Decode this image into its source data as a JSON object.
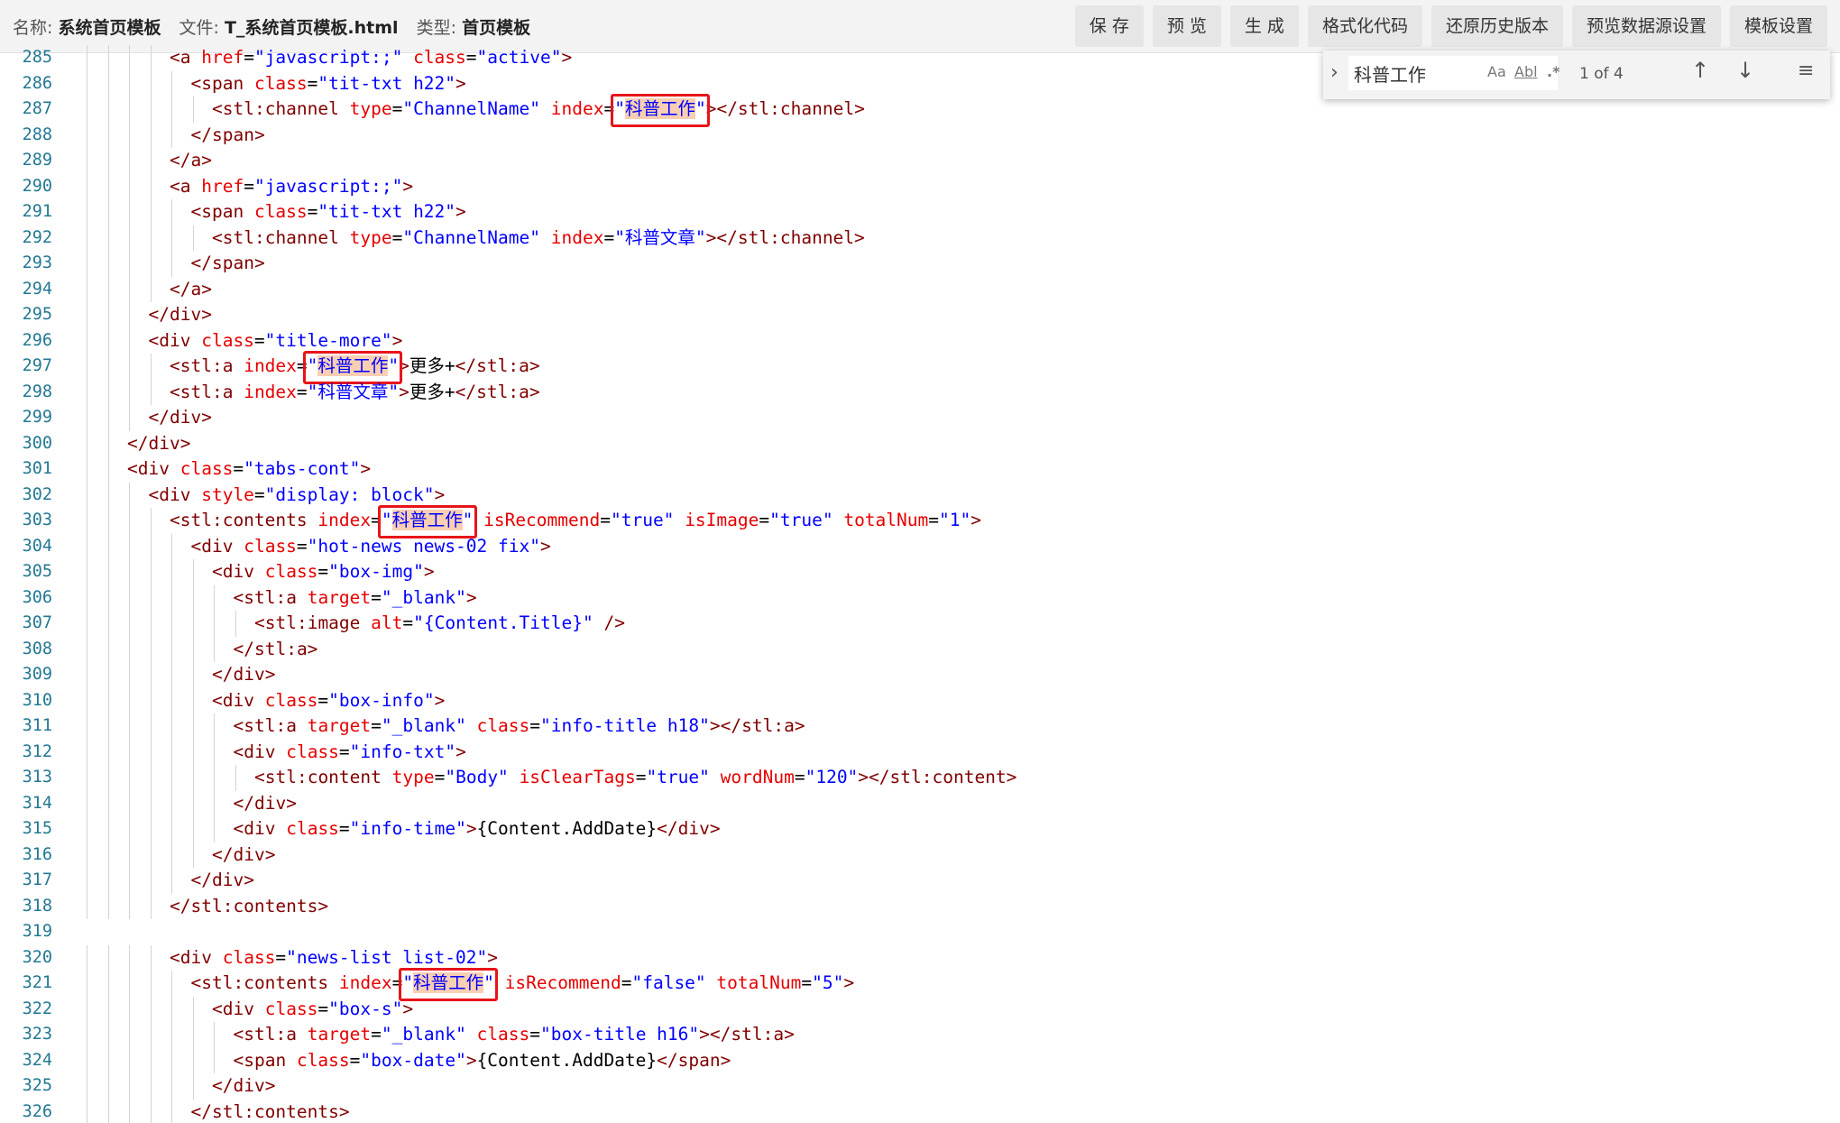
{
  "header": {
    "name_label": "名称:",
    "name_value": "系统首页模板",
    "file_label": "文件:",
    "file_value": "T_系统首页模板.html",
    "type_label": "类型:",
    "type_value": "首页模板",
    "buttons": [
      "保 存",
      "预 览",
      "生 成",
      "格式化代码",
      "还原历史版本",
      "预览数据源设置",
      "模板设置"
    ]
  },
  "find": {
    "query": "科普工作",
    "count": "1 of 4",
    "match_case_icon": "Aa",
    "whole_word_icon": "Abl",
    "regex_icon": ".*"
  },
  "colors": {
    "match_highlight": "#f8cfb3",
    "annotation_box": "#e8141a",
    "line_number": "#237893",
    "tag": "#800000",
    "attribute": "#e50000",
    "string": "#0000ff"
  },
  "editor": {
    "lines": [
      {
        "n": "285",
        "indent": 8,
        "tokens": [
          [
            "tag",
            "<a"
          ],
          [
            "txt",
            " "
          ],
          [
            "attr",
            "href"
          ],
          [
            "txt",
            "="
          ],
          [
            "str",
            "\"javascript:;\""
          ],
          [
            "txt",
            " "
          ],
          [
            "attr",
            "class"
          ],
          [
            "txt",
            "="
          ],
          [
            "str",
            "\"active\""
          ],
          [
            "tag",
            ">"
          ]
        ]
      },
      {
        "n": "286",
        "indent": 10,
        "tokens": [
          [
            "tag",
            "<span"
          ],
          [
            "txt",
            " "
          ],
          [
            "attr",
            "class"
          ],
          [
            "txt",
            "="
          ],
          [
            "str",
            "\"tit-txt h22\""
          ],
          [
            "tag",
            ">"
          ]
        ]
      },
      {
        "n": "287",
        "indent": 12,
        "tokens": [
          [
            "tag",
            "<stl:channel"
          ],
          [
            "txt",
            " "
          ],
          [
            "attr",
            "type"
          ],
          [
            "txt",
            "="
          ],
          [
            "str",
            "\"ChannelName\""
          ],
          [
            "txt",
            " "
          ],
          [
            "attr",
            "index"
          ],
          [
            "txt",
            "="
          ],
          [
            "str",
            "\""
          ],
          [
            "hl",
            "科普工作"
          ],
          [
            "str",
            "\""
          ],
          [
            "tag",
            ">"
          ],
          [
            "tag",
            "</stl:channel>"
          ]
        ],
        "boxed": true
      },
      {
        "n": "288",
        "indent": 10,
        "tokens": [
          [
            "tag",
            "</span>"
          ]
        ]
      },
      {
        "n": "289",
        "indent": 8,
        "tokens": [
          [
            "tag",
            "</a>"
          ]
        ]
      },
      {
        "n": "290",
        "indent": 8,
        "tokens": [
          [
            "tag",
            "<a"
          ],
          [
            "txt",
            " "
          ],
          [
            "attr",
            "href"
          ],
          [
            "txt",
            "="
          ],
          [
            "str",
            "\"javascript:;\""
          ],
          [
            "tag",
            ">"
          ]
        ]
      },
      {
        "n": "291",
        "indent": 10,
        "tokens": [
          [
            "tag",
            "<span"
          ],
          [
            "txt",
            " "
          ],
          [
            "attr",
            "class"
          ],
          [
            "txt",
            "="
          ],
          [
            "str",
            "\"tit-txt h22\""
          ],
          [
            "tag",
            ">"
          ]
        ]
      },
      {
        "n": "292",
        "indent": 12,
        "tokens": [
          [
            "tag",
            "<stl:channel"
          ],
          [
            "txt",
            " "
          ],
          [
            "attr",
            "type"
          ],
          [
            "txt",
            "="
          ],
          [
            "str",
            "\"ChannelName\""
          ],
          [
            "txt",
            " "
          ],
          [
            "attr",
            "index"
          ],
          [
            "txt",
            "="
          ],
          [
            "str",
            "\"科普文章\""
          ],
          [
            "tag",
            ">"
          ],
          [
            "tag",
            "</stl:channel>"
          ]
        ]
      },
      {
        "n": "293",
        "indent": 10,
        "tokens": [
          [
            "tag",
            "</span>"
          ]
        ]
      },
      {
        "n": "294",
        "indent": 8,
        "tokens": [
          [
            "tag",
            "</a>"
          ]
        ]
      },
      {
        "n": "295",
        "indent": 6,
        "tokens": [
          [
            "tag",
            "</div>"
          ]
        ]
      },
      {
        "n": "296",
        "indent": 6,
        "tokens": [
          [
            "tag",
            "<div"
          ],
          [
            "txt",
            " "
          ],
          [
            "attr",
            "class"
          ],
          [
            "txt",
            "="
          ],
          [
            "str",
            "\"title-more\""
          ],
          [
            "tag",
            ">"
          ]
        ]
      },
      {
        "n": "297",
        "indent": 8,
        "tokens": [
          [
            "tag",
            "<stl:a"
          ],
          [
            "txt",
            " "
          ],
          [
            "attr",
            "index"
          ],
          [
            "txt",
            "="
          ],
          [
            "str",
            "\""
          ],
          [
            "hl",
            "科普工作"
          ],
          [
            "str",
            "\""
          ],
          [
            "tag",
            ">"
          ],
          [
            "txt",
            "更多+"
          ],
          [
            "tag",
            "</stl:a>"
          ]
        ],
        "boxed": true
      },
      {
        "n": "298",
        "indent": 8,
        "tokens": [
          [
            "tag",
            "<stl:a"
          ],
          [
            "txt",
            " "
          ],
          [
            "attr",
            "index"
          ],
          [
            "txt",
            "="
          ],
          [
            "str",
            "\"科普文章\""
          ],
          [
            "tag",
            ">"
          ],
          [
            "txt",
            "更多+"
          ],
          [
            "tag",
            "</stl:a>"
          ]
        ]
      },
      {
        "n": "299",
        "indent": 6,
        "tokens": [
          [
            "tag",
            "</div>"
          ]
        ]
      },
      {
        "n": "300",
        "indent": 4,
        "tokens": [
          [
            "tag",
            "</div>"
          ]
        ]
      },
      {
        "n": "301",
        "indent": 4,
        "tokens": [
          [
            "tag",
            "<div"
          ],
          [
            "txt",
            " "
          ],
          [
            "attr",
            "class"
          ],
          [
            "txt",
            "="
          ],
          [
            "str",
            "\"tabs-cont\""
          ],
          [
            "tag",
            ">"
          ]
        ]
      },
      {
        "n": "302",
        "indent": 6,
        "tokens": [
          [
            "tag",
            "<div"
          ],
          [
            "txt",
            " "
          ],
          [
            "attr",
            "style"
          ],
          [
            "txt",
            "="
          ],
          [
            "str",
            "\"display: block\""
          ],
          [
            "tag",
            ">"
          ]
        ]
      },
      {
        "n": "303",
        "indent": 8,
        "tokens": [
          [
            "tag",
            "<stl:contents"
          ],
          [
            "txt",
            " "
          ],
          [
            "attr",
            "index"
          ],
          [
            "txt",
            "="
          ],
          [
            "str",
            "\""
          ],
          [
            "hl",
            "科普工作"
          ],
          [
            "str",
            "\""
          ],
          [
            "txt",
            " "
          ],
          [
            "attr",
            "isRecommend"
          ],
          [
            "txt",
            "="
          ],
          [
            "str",
            "\"true\""
          ],
          [
            "txt",
            " "
          ],
          [
            "attr",
            "isImage"
          ],
          [
            "txt",
            "="
          ],
          [
            "str",
            "\"true\""
          ],
          [
            "txt",
            " "
          ],
          [
            "attr",
            "totalNum"
          ],
          [
            "txt",
            "="
          ],
          [
            "str",
            "\"1\""
          ],
          [
            "tag",
            ">"
          ]
        ],
        "boxed": true
      },
      {
        "n": "304",
        "indent": 10,
        "tokens": [
          [
            "tag",
            "<div"
          ],
          [
            "txt",
            " "
          ],
          [
            "attr",
            "class"
          ],
          [
            "txt",
            "="
          ],
          [
            "str",
            "\"hot-news news-02 fix\""
          ],
          [
            "tag",
            ">"
          ]
        ]
      },
      {
        "n": "305",
        "indent": 12,
        "tokens": [
          [
            "tag",
            "<div"
          ],
          [
            "txt",
            " "
          ],
          [
            "attr",
            "class"
          ],
          [
            "txt",
            "="
          ],
          [
            "str",
            "\"box-img\""
          ],
          [
            "tag",
            ">"
          ]
        ]
      },
      {
        "n": "306",
        "indent": 14,
        "tokens": [
          [
            "tag",
            "<stl:a"
          ],
          [
            "txt",
            " "
          ],
          [
            "attr",
            "target"
          ],
          [
            "txt",
            "="
          ],
          [
            "str",
            "\"_blank\""
          ],
          [
            "tag",
            ">"
          ]
        ]
      },
      {
        "n": "307",
        "indent": 16,
        "tokens": [
          [
            "tag",
            "<stl:image"
          ],
          [
            "txt",
            " "
          ],
          [
            "attr",
            "alt"
          ],
          [
            "txt",
            "="
          ],
          [
            "str",
            "\"{Content.Title}\""
          ],
          [
            "txt",
            " "
          ],
          [
            "tag",
            "/>"
          ]
        ]
      },
      {
        "n": "308",
        "indent": 14,
        "tokens": [
          [
            "tag",
            "</stl:a>"
          ]
        ]
      },
      {
        "n": "309",
        "indent": 12,
        "tokens": [
          [
            "tag",
            "</div>"
          ]
        ]
      },
      {
        "n": "310",
        "indent": 12,
        "tokens": [
          [
            "tag",
            "<div"
          ],
          [
            "txt",
            " "
          ],
          [
            "attr",
            "class"
          ],
          [
            "txt",
            "="
          ],
          [
            "str",
            "\"box-info\""
          ],
          [
            "tag",
            ">"
          ]
        ]
      },
      {
        "n": "311",
        "indent": 14,
        "tokens": [
          [
            "tag",
            "<stl:a"
          ],
          [
            "txt",
            " "
          ],
          [
            "attr",
            "target"
          ],
          [
            "txt",
            "="
          ],
          [
            "str",
            "\"_blank\""
          ],
          [
            "txt",
            " "
          ],
          [
            "attr",
            "class"
          ],
          [
            "txt",
            "="
          ],
          [
            "str",
            "\"info-title h18\""
          ],
          [
            "tag",
            ">"
          ],
          [
            "tag",
            "</stl:a>"
          ]
        ]
      },
      {
        "n": "312",
        "indent": 14,
        "tokens": [
          [
            "tag",
            "<div"
          ],
          [
            "txt",
            " "
          ],
          [
            "attr",
            "class"
          ],
          [
            "txt",
            "="
          ],
          [
            "str",
            "\"info-txt\""
          ],
          [
            "tag",
            ">"
          ]
        ]
      },
      {
        "n": "313",
        "indent": 16,
        "tokens": [
          [
            "tag",
            "<stl:content"
          ],
          [
            "txt",
            " "
          ],
          [
            "attr",
            "type"
          ],
          [
            "txt",
            "="
          ],
          [
            "str",
            "\"Body\""
          ],
          [
            "txt",
            " "
          ],
          [
            "attr",
            "isClearTags"
          ],
          [
            "txt",
            "="
          ],
          [
            "str",
            "\"true\""
          ],
          [
            "txt",
            " "
          ],
          [
            "attr",
            "wordNum"
          ],
          [
            "txt",
            "="
          ],
          [
            "str",
            "\"120\""
          ],
          [
            "tag",
            ">"
          ],
          [
            "tag",
            "</stl:content>"
          ]
        ]
      },
      {
        "n": "314",
        "indent": 14,
        "tokens": [
          [
            "tag",
            "</div>"
          ]
        ]
      },
      {
        "n": "315",
        "indent": 14,
        "tokens": [
          [
            "tag",
            "<div"
          ],
          [
            "txt",
            " "
          ],
          [
            "attr",
            "class"
          ],
          [
            "txt",
            "="
          ],
          [
            "str",
            "\"info-time\""
          ],
          [
            "tag",
            ">"
          ],
          [
            "txt",
            "{Content.AddDate}"
          ],
          [
            "tag",
            "</div>"
          ]
        ]
      },
      {
        "n": "316",
        "indent": 12,
        "tokens": [
          [
            "tag",
            "</div>"
          ]
        ]
      },
      {
        "n": "317",
        "indent": 10,
        "tokens": [
          [
            "tag",
            "</div>"
          ]
        ]
      },
      {
        "n": "318",
        "indent": 8,
        "tokens": [
          [
            "tag",
            "</stl:contents>"
          ]
        ]
      },
      {
        "n": "319",
        "indent": 0,
        "tokens": []
      },
      {
        "n": "320",
        "indent": 8,
        "tokens": [
          [
            "tag",
            "<div"
          ],
          [
            "txt",
            " "
          ],
          [
            "attr",
            "class"
          ],
          [
            "txt",
            "="
          ],
          [
            "str",
            "\"news-list list-02\""
          ],
          [
            "tag",
            ">"
          ]
        ]
      },
      {
        "n": "321",
        "indent": 10,
        "tokens": [
          [
            "tag",
            "<stl:contents"
          ],
          [
            "txt",
            " "
          ],
          [
            "attr",
            "index"
          ],
          [
            "txt",
            "="
          ],
          [
            "str",
            "\""
          ],
          [
            "hl",
            "科普工作"
          ],
          [
            "str",
            "\""
          ],
          [
            "txt",
            " "
          ],
          [
            "attr",
            "isRecommend"
          ],
          [
            "txt",
            "="
          ],
          [
            "str",
            "\"false\""
          ],
          [
            "txt",
            " "
          ],
          [
            "attr",
            "totalNum"
          ],
          [
            "txt",
            "="
          ],
          [
            "str",
            "\"5\""
          ],
          [
            "tag",
            ">"
          ]
        ],
        "boxed": true
      },
      {
        "n": "322",
        "indent": 12,
        "tokens": [
          [
            "tag",
            "<div"
          ],
          [
            "txt",
            " "
          ],
          [
            "attr",
            "class"
          ],
          [
            "txt",
            "="
          ],
          [
            "str",
            "\"box-s\""
          ],
          [
            "tag",
            ">"
          ]
        ]
      },
      {
        "n": "323",
        "indent": 14,
        "tokens": [
          [
            "tag",
            "<stl:a"
          ],
          [
            "txt",
            " "
          ],
          [
            "attr",
            "target"
          ],
          [
            "txt",
            "="
          ],
          [
            "str",
            "\"_blank\""
          ],
          [
            "txt",
            " "
          ],
          [
            "attr",
            "class"
          ],
          [
            "txt",
            "="
          ],
          [
            "str",
            "\"box-title h16\""
          ],
          [
            "tag",
            ">"
          ],
          [
            "tag",
            "</stl:a>"
          ]
        ]
      },
      {
        "n": "324",
        "indent": 14,
        "tokens": [
          [
            "tag",
            "<span"
          ],
          [
            "txt",
            " "
          ],
          [
            "attr",
            "class"
          ],
          [
            "txt",
            "="
          ],
          [
            "str",
            "\"box-date\""
          ],
          [
            "tag",
            ">"
          ],
          [
            "txt",
            "{Content.AddDate}"
          ],
          [
            "tag",
            "</span>"
          ]
        ]
      },
      {
        "n": "325",
        "indent": 12,
        "tokens": [
          [
            "tag",
            "</div>"
          ]
        ]
      },
      {
        "n": "326",
        "indent": 10,
        "tokens": [
          [
            "tag",
            "</stl:contents>"
          ]
        ]
      }
    ]
  }
}
